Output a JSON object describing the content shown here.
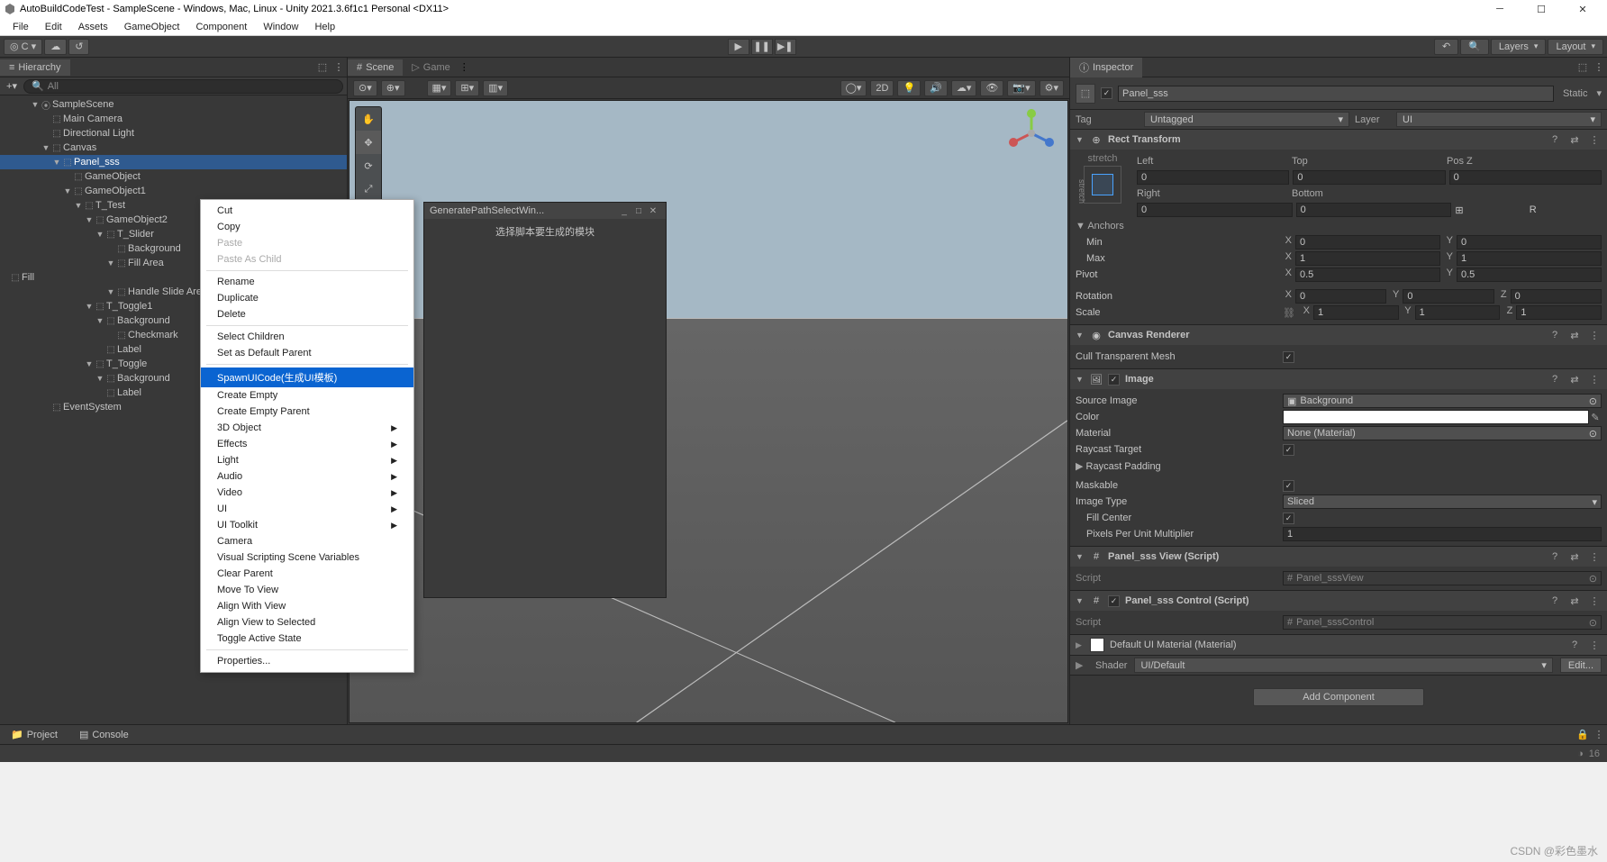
{
  "window": {
    "title": "AutoBuildCodeTest - SampleScene - Windows, Mac, Linux - Unity 2021.3.6f1c1 Personal <DX11>"
  },
  "menubar": [
    "File",
    "Edit",
    "Assets",
    "GameObject",
    "Component",
    "Window",
    "Help"
  ],
  "toolbar": {
    "layers": "Layers",
    "layout": "Layout"
  },
  "hierarchy": {
    "title": "Hierarchy",
    "search_placeholder": "All",
    "scene": "SampleScene",
    "items": [
      {
        "t": "Main Camera",
        "i": 1,
        "a": false
      },
      {
        "t": "Directional Light",
        "i": 1,
        "a": false
      },
      {
        "t": "Canvas",
        "i": 1,
        "a": true
      },
      {
        "t": "Panel_sss",
        "i": 2,
        "a": true,
        "sel": true
      },
      {
        "t": "GameObject",
        "i": 3,
        "a": false
      },
      {
        "t": "GameObject1",
        "i": 3,
        "a": true
      },
      {
        "t": "T_Test",
        "i": 4,
        "a": true
      },
      {
        "t": "GameObject2",
        "i": 5,
        "a": true
      },
      {
        "t": "T_Slider",
        "i": 6,
        "a": true
      },
      {
        "t": "Background",
        "i": 7,
        "a": false
      },
      {
        "t": "Fill Area",
        "i": 7,
        "a": true
      },
      {
        "t": "Fill",
        "i": 8,
        "a": false
      },
      {
        "t": "Handle Slide Area",
        "i": 7,
        "a": true
      },
      {
        "t": "T_Toggle1",
        "i": 5,
        "a": true
      },
      {
        "t": "Background",
        "i": 6,
        "a": true
      },
      {
        "t": "Checkmark",
        "i": 7,
        "a": false
      },
      {
        "t": "Label",
        "i": 6,
        "a": false
      },
      {
        "t": "T_Toggle",
        "i": 5,
        "a": true
      },
      {
        "t": "Background",
        "i": 6,
        "a": true
      },
      {
        "t": "Label",
        "i": 6,
        "a": false
      },
      {
        "t": "EventSystem",
        "i": 1,
        "a": false
      }
    ]
  },
  "scene": {
    "tab_scene": "Scene",
    "tab_game": "Game",
    "mode_2d": "2D"
  },
  "popup": {
    "title": "GeneratePathSelectWin...",
    "message": "选择脚本要生成的模块"
  },
  "context_menu": {
    "cut": "Cut",
    "copy": "Copy",
    "paste": "Paste",
    "paste_as_child": "Paste As Child",
    "rename": "Rename",
    "duplicate": "Duplicate",
    "delete": "Delete",
    "select_children": "Select Children",
    "set_default_parent": "Set as Default Parent",
    "spawn_ui": "SpawnUICode(生成UI模板)",
    "create_empty": "Create Empty",
    "create_empty_parent": "Create Empty Parent",
    "three_d_object": "3D Object",
    "effects": "Effects",
    "light": "Light",
    "audio": "Audio",
    "video": "Video",
    "ui": "UI",
    "ui_toolkit": "UI Toolkit",
    "camera": "Camera",
    "vs_vars": "Visual Scripting Scene Variables",
    "clear_parent": "Clear Parent",
    "move_to_view": "Move To View",
    "align_with_view": "Align With View",
    "align_view_to_selected": "Align View to Selected",
    "toggle_active": "Toggle Active State",
    "properties": "Properties..."
  },
  "inspector": {
    "title": "Inspector",
    "name": "Panel_sss",
    "static": "Static",
    "tag_lbl": "Tag",
    "tag_val": "Untagged",
    "layer_lbl": "Layer",
    "layer_val": "UI",
    "rect": {
      "title": "Rect Transform",
      "stretch": "stretch",
      "left": "Left",
      "left_v": "0",
      "top": "Top",
      "top_v": "0",
      "posz": "Pos Z",
      "posz_v": "0",
      "right": "Right",
      "right_v": "0",
      "bottom": "Bottom",
      "bottom_v": "0",
      "anchors": "Anchors",
      "min": "Min",
      "min_x": "0",
      "min_y": "0",
      "max": "Max",
      "max_x": "1",
      "max_y": "1",
      "pivot": "Pivot",
      "pivot_x": "0.5",
      "pivot_y": "0.5",
      "rotation": "Rotation",
      "rot_x": "0",
      "rot_y": "0",
      "rot_z": "0",
      "scale": "Scale",
      "scl_x": "1",
      "scl_y": "1",
      "scl_z": "1"
    },
    "canvas_renderer": {
      "title": "Canvas Renderer",
      "cull": "Cull Transparent Mesh"
    },
    "image": {
      "title": "Image",
      "source": "Source Image",
      "source_v": "Background",
      "color": "Color",
      "material": "Material",
      "material_v": "None (Material)",
      "raycast": "Raycast Target",
      "raycast_pad": "Raycast Padding",
      "maskable": "Maskable",
      "type": "Image Type",
      "type_v": "Sliced",
      "fill_center": "Fill Center",
      "ppu": "Pixels Per Unit Multiplier",
      "ppu_v": "1"
    },
    "view_script": {
      "title": "Panel_sss View (Script)",
      "script_lbl": "Script",
      "script_v": "Panel_sssView"
    },
    "control_script": {
      "title": "Panel_sss Control (Script)",
      "script_lbl": "Script",
      "script_v": "Panel_sssControl"
    },
    "material": {
      "title": "Default UI Material (Material)",
      "shader_lbl": "Shader",
      "shader_v": "UI/Default",
      "edit": "Edit..."
    },
    "add_component": "Add Component"
  },
  "bottom": {
    "project": "Project",
    "console": "Console",
    "count": "16"
  },
  "watermark": "CSDN @彩色墨水"
}
